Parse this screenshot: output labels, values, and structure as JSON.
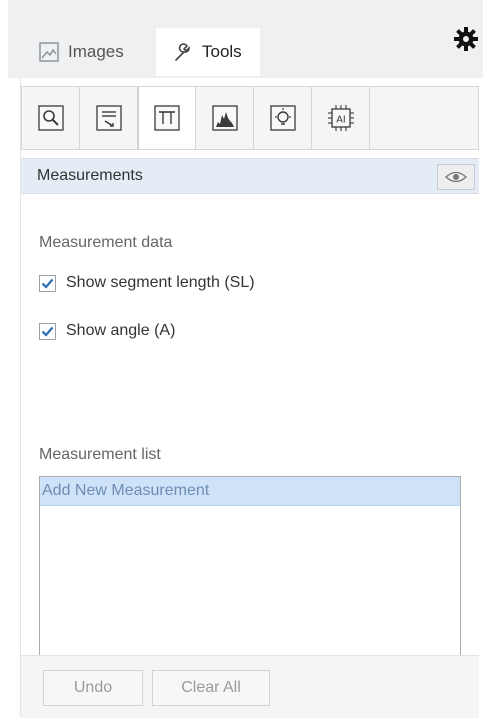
{
  "tabs": {
    "images_label": "Images",
    "tools_label": "Tools"
  },
  "toolbar": {
    "tools": [
      {
        "icon": "search-zoom-icon"
      },
      {
        "icon": "annotation-icon"
      },
      {
        "icon": "measurement-icon",
        "active": true
      },
      {
        "icon": "histogram-icon"
      },
      {
        "icon": "light-bulb-icon"
      },
      {
        "icon": "ai-chip-icon",
        "text": "AI"
      }
    ]
  },
  "measurements": {
    "title": "Measurements",
    "data_label": "Measurement data",
    "show_segment_length": {
      "label": "Show segment length (SL)",
      "checked": true
    },
    "show_angle": {
      "label": "Show angle (A)",
      "checked": true
    },
    "list_label": "Measurement list",
    "list_items": [
      "Add New Measurement"
    ]
  },
  "actions": {
    "undo": "Undo",
    "clear_all": "Clear All"
  },
  "colors": {
    "accent": "#2a6db4",
    "selected_item_bg": "#cfe3f8",
    "section_header_bg": "#e4ecf6"
  }
}
